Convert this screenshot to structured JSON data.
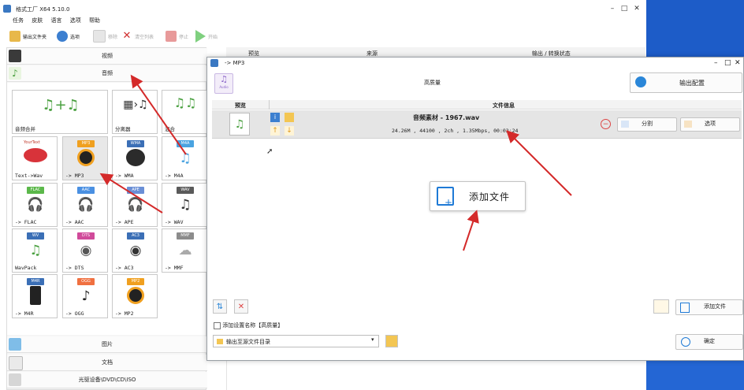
{
  "app": {
    "title": "格式工厂 X64 5.10.0",
    "menu": [
      "任务",
      "皮肤",
      "语言",
      "选项",
      "帮助"
    ],
    "toolbar": {
      "output_folder": "输出文件夹",
      "options": "选项",
      "remove": "移除",
      "clear_list": "清空列表",
      "stop": "停止",
      "start": "开始"
    },
    "categories": {
      "video": "视频",
      "audio": "音频",
      "picture": "图片",
      "document": "文档",
      "disc": "光驱设备\\DVD\\CD\\ISO"
    },
    "tiles": [
      {
        "label": "音频合并",
        "badge": "",
        "color": "#5bb84a"
      },
      {
        "label": "分离器",
        "badge": "",
        "color": "#3c7fd0"
      },
      {
        "label": "混合",
        "badge": "",
        "color": "#5bb84a"
      },
      {
        "label": "Text->Wav",
        "badge": "YourText",
        "color": "#e25a4a"
      },
      {
        "label": "-> MP3",
        "badge": "MP3",
        "color": "#f0a020"
      },
      {
        "label": "-> WMA",
        "badge": "WMA",
        "color": "#3b6fb6"
      },
      {
        "label": "-> M4A",
        "badge": "M4A",
        "color": "#4aa3e0"
      },
      {
        "label": "-> FLAC",
        "badge": "FLAC",
        "color": "#5bb84a"
      },
      {
        "label": "-> AAC",
        "badge": "AAC",
        "color": "#4a90e2"
      },
      {
        "label": "-> APE",
        "badge": "APE",
        "color": "#6a8fd6"
      },
      {
        "label": "-> WAV",
        "badge": "WAV",
        "color": "#5a5a5a"
      },
      {
        "label": "WavPack",
        "badge": "WV",
        "color": "#3b6fb6"
      },
      {
        "label": "-> DTS",
        "badge": "DTS",
        "color": "#d04a9a"
      },
      {
        "label": "-> AC3",
        "badge": "AC3",
        "color": "#3b6fb6"
      },
      {
        "label": "-> MMF",
        "badge": "MMF",
        "color": "#8c8c8c"
      },
      {
        "label": "-> M4R",
        "badge": "M4R",
        "color": "#3b6fb6"
      },
      {
        "label": "-> OGG",
        "badge": "OGG",
        "color": "#f07040"
      },
      {
        "label": "-> MP2",
        "badge": "MP2",
        "color": "#f0a020"
      }
    ],
    "bg_table": {
      "col_preview": "预览",
      "col_source": "来源",
      "col_output": "输出 / 转换状态"
    }
  },
  "dialog": {
    "title": "-> MP3",
    "quality": "高质量",
    "output_config": "输出配置",
    "format_icon_label": "Audio",
    "col_preview": "预览",
    "col_fileinfo": "文件信息",
    "file": {
      "name": "音频素材 - 1967.wav",
      "details": "24.26M , 44100 , 2ch , 1.35Mbps, 00:02:24"
    },
    "split": "分割",
    "options": "选项",
    "add_file_big": "添加文件",
    "add_setting_name": "添加设置名称【高质量】",
    "output_dir": "输出至源文件目录",
    "add_file": "添加文件",
    "ok": "确定"
  },
  "colors": {
    "accent": "#1e7ad6",
    "arrow": "#d42a2a",
    "desktop": "#2466d4"
  }
}
